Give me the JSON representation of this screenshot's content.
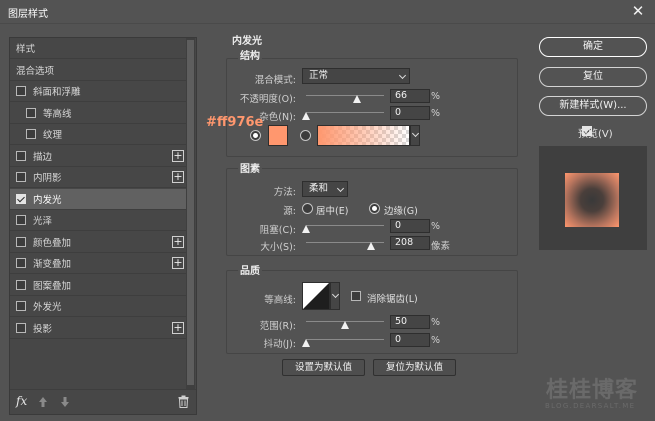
{
  "window": {
    "title": "图层样式",
    "close_glyph": "✕"
  },
  "sidebar": {
    "items": [
      {
        "label": "样式",
        "checkbox": false,
        "checked": false,
        "plus": false,
        "indent": 0,
        "selected": false
      },
      {
        "label": "混合选项",
        "checkbox": false,
        "checked": false,
        "plus": false,
        "indent": 0,
        "selected": false
      },
      {
        "label": "斜面和浮雕",
        "checkbox": true,
        "checked": false,
        "plus": false,
        "indent": 0,
        "selected": false
      },
      {
        "label": "等高线",
        "checkbox": true,
        "checked": false,
        "plus": false,
        "indent": 1,
        "selected": false
      },
      {
        "label": "纹理",
        "checkbox": true,
        "checked": false,
        "plus": false,
        "indent": 1,
        "selected": false
      },
      {
        "label": "描边",
        "checkbox": true,
        "checked": false,
        "plus": true,
        "indent": 0,
        "selected": false
      },
      {
        "label": "内阴影",
        "checkbox": true,
        "checked": false,
        "plus": true,
        "indent": 0,
        "selected": false
      },
      {
        "label": "内发光",
        "checkbox": true,
        "checked": true,
        "plus": false,
        "indent": 0,
        "selected": true
      },
      {
        "label": "光泽",
        "checkbox": true,
        "checked": false,
        "plus": false,
        "indent": 0,
        "selected": false
      },
      {
        "label": "颜色叠加",
        "checkbox": true,
        "checked": false,
        "plus": true,
        "indent": 0,
        "selected": false
      },
      {
        "label": "渐变叠加",
        "checkbox": true,
        "checked": false,
        "plus": true,
        "indent": 0,
        "selected": false
      },
      {
        "label": "图案叠加",
        "checkbox": true,
        "checked": false,
        "plus": false,
        "indent": 0,
        "selected": false
      },
      {
        "label": "外发光",
        "checkbox": true,
        "checked": false,
        "plus": false,
        "indent": 0,
        "selected": false
      },
      {
        "label": "投影",
        "checkbox": true,
        "checked": false,
        "plus": true,
        "indent": 0,
        "selected": false
      }
    ],
    "footer": {
      "fx_label": "fx"
    }
  },
  "panel": {
    "title": "内发光",
    "structure": {
      "title": "结构",
      "blend_mode": {
        "label": "混合模式:",
        "value": "正常"
      },
      "opacity": {
        "label": "不透明度(O):",
        "value": "66",
        "unit": "%",
        "level": 0.66
      },
      "noise": {
        "label": "杂色(N):",
        "value": "0",
        "unit": "%",
        "level": 0
      },
      "color_hex": "#ff976e"
    },
    "elements": {
      "title": "图素",
      "technique": {
        "label": "方法:",
        "value": "柔和"
      },
      "source": {
        "label": "源:",
        "center_label": "居中(E)",
        "edge_label": "边缘(G)",
        "selected": "edge"
      },
      "choke": {
        "label": "阻塞(C):",
        "value": "0",
        "unit": "%",
        "level": 0
      },
      "size": {
        "label": "大小(S):",
        "value": "208",
        "unit": "像素",
        "level": 0.83
      }
    },
    "quality": {
      "title": "品质",
      "contour": {
        "label": "等高线:",
        "anti_alias_label": "消除锯齿(L)",
        "anti_alias_checked": false
      },
      "range": {
        "label": "范围(R):",
        "value": "50",
        "unit": "%",
        "level": 0.5
      },
      "jitter": {
        "label": "抖动(J):",
        "value": "0",
        "unit": "%",
        "level": 0
      }
    },
    "buttons": {
      "make_default": "设置为默认值",
      "reset_default": "复位为默认值"
    }
  },
  "right": {
    "ok": "确定",
    "reset": "复位",
    "new_style": "新建样式(W)...",
    "preview_label": "预览(V)",
    "preview_checked": true
  },
  "annotation": {
    "hex_text": "#ff976e"
  },
  "watermark": {
    "main": "桂桂博客",
    "sub": "BLOG.DEARSALT.ME"
  },
  "colors": {
    "accent": "#ff976e",
    "bg": "#535353"
  }
}
